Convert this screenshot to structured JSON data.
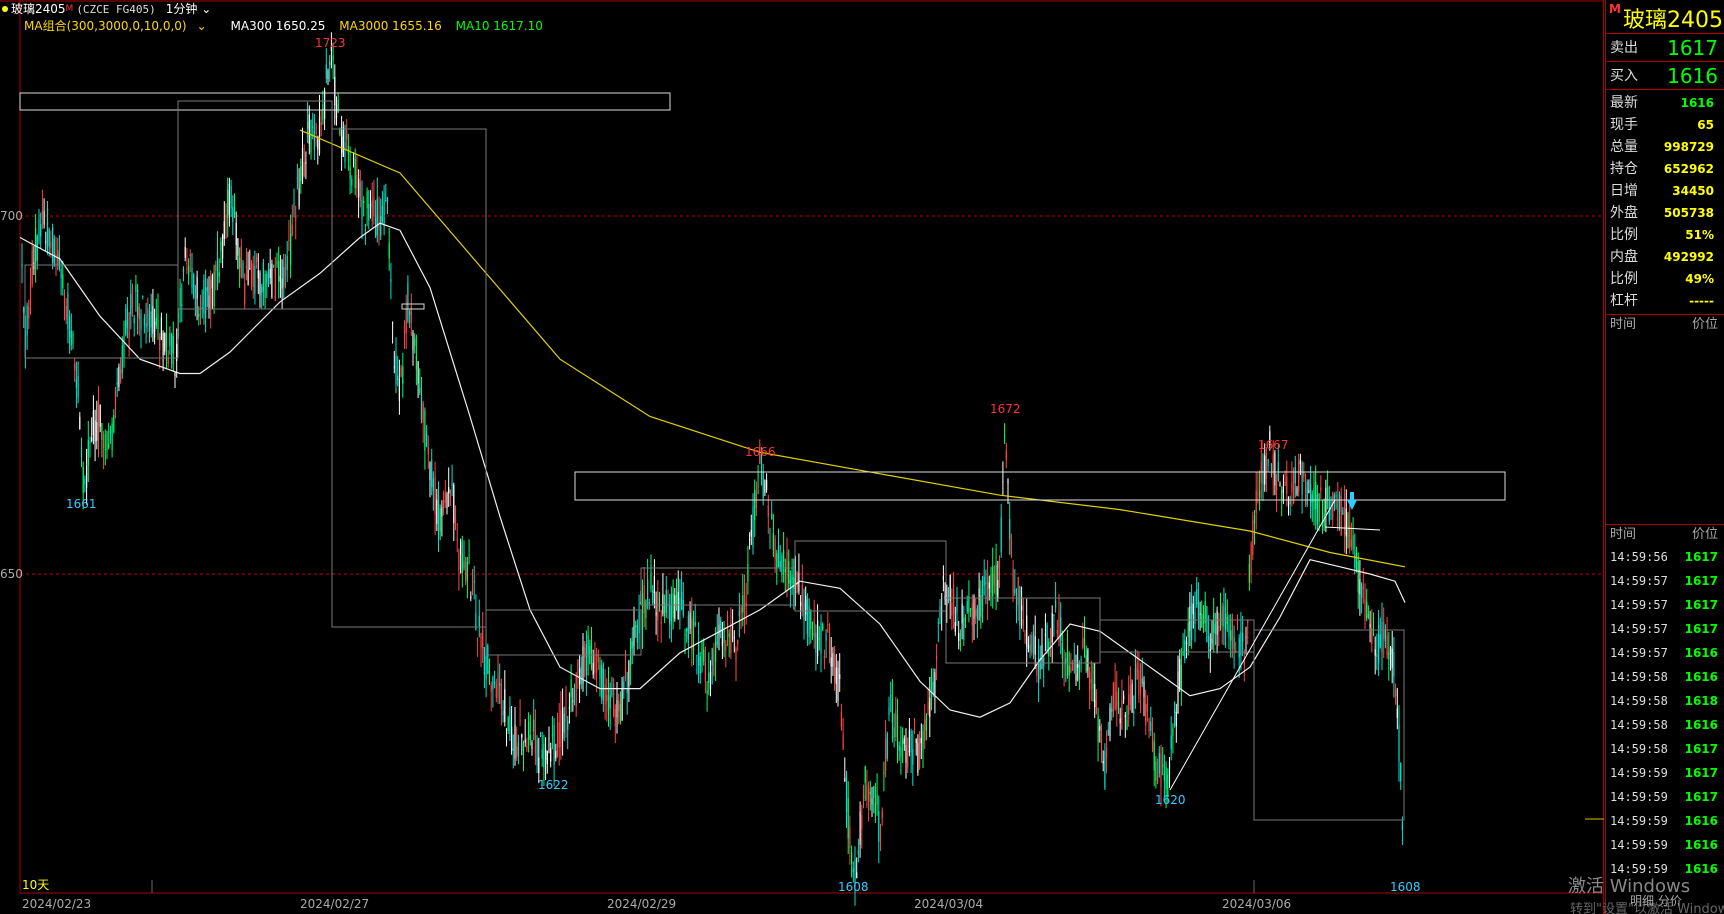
{
  "header": {
    "symbol": "玻璃2405",
    "marker": "M",
    "code": "(CZCE FG405)",
    "period": "1分钟"
  },
  "ma": {
    "group": "MA组合(300,3000,0,10,0,0)",
    "ma300": "MA300 1650.25",
    "ma3000": "MA3000 1655.16",
    "ma10": "MA10 1617.10",
    "colors": {
      "group": "#ffd700",
      "ma300": "#ffffff",
      "ma3000": "#ffd700",
      "ma10": "#00ff00"
    }
  },
  "axis": {
    "y_labels": [
      "700",
      "650"
    ],
    "range_label": "10天",
    "dates": [
      "2024/02/23",
      "2024/02/27",
      "2024/02/29",
      "2024/03/04",
      "2024/03/06"
    ]
  },
  "peaks": [
    {
      "label": "1723",
      "color": "#ff3333"
    },
    {
      "label": "1661",
      "color": "#33ccff"
    },
    {
      "label": "1666",
      "color": "#ff3333"
    },
    {
      "label": "1622",
      "color": "#33ccff"
    },
    {
      "label": "1672",
      "color": "#ff3333"
    },
    {
      "label": "1608",
      "color": "#33ccff"
    },
    {
      "label": "1620",
      "color": "#33ccff"
    },
    {
      "label": "1667",
      "color": "#ff3333"
    },
    {
      "label": "1608",
      "color": "#33ccff"
    }
  ],
  "panel": {
    "marker": "M",
    "name": "玻璃2405",
    "sell_label": "卖出",
    "sell_value": "1617",
    "buy_label": "买入",
    "buy_value": "1616",
    "stats": [
      {
        "label": "最新",
        "value": "1616",
        "color": "#00ff00"
      },
      {
        "label": "现手",
        "value": "65",
        "color": "#ffff00"
      },
      {
        "label": "总量",
        "value": "998729",
        "color": "#ffff00"
      },
      {
        "label": "持仓",
        "value": "652962",
        "color": "#ffff00"
      },
      {
        "label": "日增",
        "value": "34450",
        "color": "#ffff00"
      },
      {
        "label": "外盘",
        "value": "505738",
        "color": "#ffff00"
      },
      {
        "label": "比例",
        "value": "51%",
        "color": "#ffff00"
      },
      {
        "label": "内盘",
        "value": "492992",
        "color": "#ffff00"
      },
      {
        "label": "比例",
        "value": "49%",
        "color": "#ffff00"
      },
      {
        "label": "杠杆",
        "value": "-----",
        "color": "#ffff00"
      }
    ],
    "section1": {
      "left": "时间",
      "right": "价位"
    },
    "section2": {
      "left": "时间",
      "right": "价位"
    },
    "ticks": [
      {
        "time": "14:59:56",
        "price": "1617"
      },
      {
        "time": "14:59:57",
        "price": "1617"
      },
      {
        "time": "14:59:57",
        "price": "1617"
      },
      {
        "time": "14:59:57",
        "price": "1617"
      },
      {
        "time": "14:59:57",
        "price": "1616"
      },
      {
        "time": "14:59:58",
        "price": "1616"
      },
      {
        "time": "14:59:58",
        "price": "1618"
      },
      {
        "time": "14:59:58",
        "price": "1616"
      },
      {
        "time": "14:59:58",
        "price": "1617"
      },
      {
        "time": "14:59:59",
        "price": "1617"
      },
      {
        "time": "14:59:59",
        "price": "1617"
      },
      {
        "time": "14:59:59",
        "price": "1616"
      },
      {
        "time": "14:59:59",
        "price": "1616"
      },
      {
        "time": "14:59:59",
        "price": "1616"
      }
    ],
    "status": "明细 分价"
  },
  "watermark": {
    "line1": "激活 Windows",
    "line2": "转到\"设置\"以激活 Windows。"
  },
  "chart_data": {
    "type": "line",
    "title": "",
    "xlabel": "",
    "ylabel": "",
    "ylim": [
      1600,
      1730
    ],
    "x": [
      "2024/02/23",
      "2024/02/27",
      "2024/02/29",
      "2024/03/04",
      "2024/03/06"
    ],
    "series": [
      {
        "name": "MA300",
        "color": "#ffffff"
      },
      {
        "name": "MA3000",
        "color": "#ffd700"
      },
      {
        "name": "MA10",
        "color": "#00ff00"
      }
    ],
    "extremes": [
      1723,
      1661,
      1666,
      1622,
      1672,
      1608,
      1620,
      1667,
      1608
    ]
  }
}
